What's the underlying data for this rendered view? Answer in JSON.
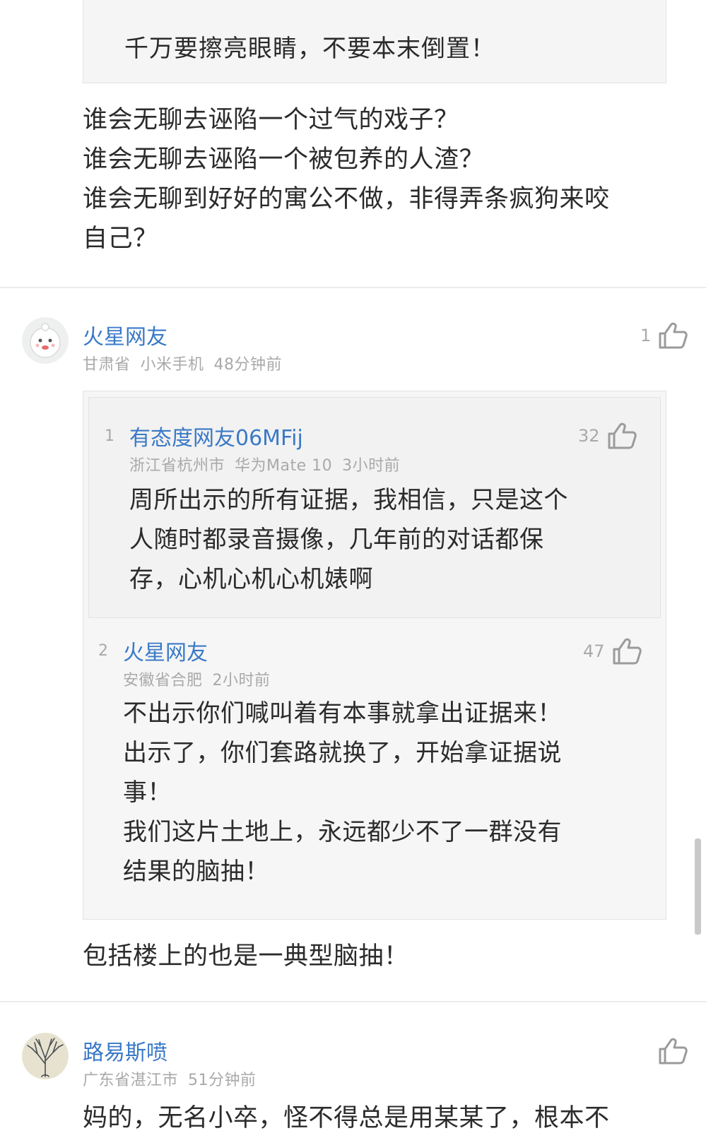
{
  "top_comment": {
    "quote_text": "千万要擦亮眼睛，不要本末倒置！",
    "lines": [
      "谁会无聊去诬陷一个过气的戏子？",
      "谁会无聊去诬陷一个被包养的人渣？",
      "谁会无聊到好好的寓公不做，非得弄条疯狗来咬",
      "自己？"
    ]
  },
  "comment_1": {
    "username": "火星网友",
    "location": "甘肃省",
    "device": "小米手机",
    "time": "48分钟前",
    "likes": "1",
    "quotes": [
      {
        "index": "1",
        "username": "有态度网友06MFij",
        "location": "浙江省杭州市",
        "device": "华为Mate 10",
        "time": "3小时前",
        "likes": "32",
        "lines": [
          "周所出示的所有证据，我相信，只是这个",
          "人随时都录音摄像，几年前的对话都保",
          "存，心机心机心机婊啊"
        ]
      },
      {
        "index": "2",
        "username": "火星网友",
        "location": "安徽省合肥",
        "time": "2小时前",
        "likes": "47",
        "lines": [
          "不出示你们喊叫着有本事就拿出证据来！",
          "出示了，你们套路就换了，开始拿证据说",
          "事！",
          "我们这片土地上，永远都少不了一群没有",
          "结果的脑抽！"
        ]
      }
    ],
    "body": "包括楼上的也是一典型脑抽！"
  },
  "comment_2": {
    "username": "路易斯喷",
    "location": "广东省湛江市",
    "time": "51分钟前",
    "body": "妈的，无名小卒，怪不得总是用某某了，根本不"
  },
  "icons": {
    "like": "thumbs-up-icon",
    "avatar_1": "cartoon-face-avatar",
    "avatar_2": "tree-avatar"
  },
  "colors": {
    "username": "#3a79c7",
    "meta": "#a9a9a9",
    "text": "#2b2b2b"
  }
}
